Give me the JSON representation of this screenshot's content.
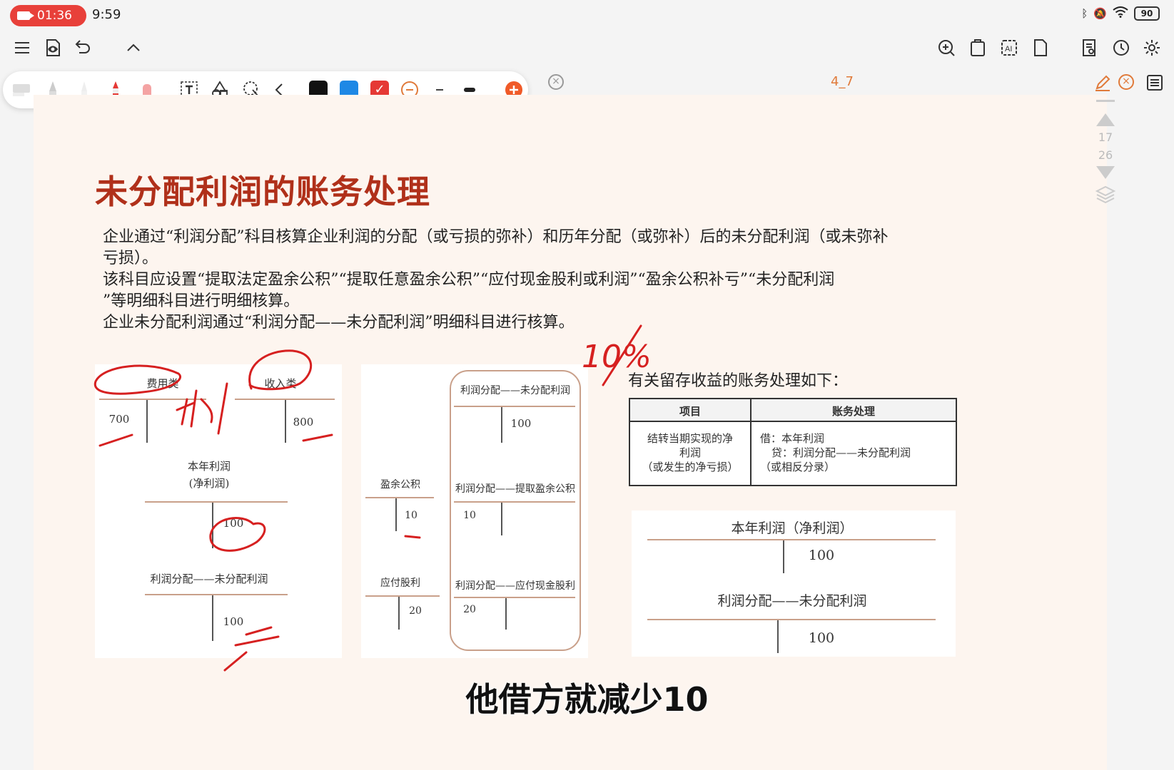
{
  "status": {
    "recording_time": "01:36",
    "clock": "9:59",
    "battery": "90"
  },
  "document": {
    "title": "4_7",
    "page_numbers": [
      "17",
      "26"
    ]
  },
  "slide": {
    "title": "未分配利润的账务处理",
    "paragraphs": [
      "企业通过“利润分配”科目核算企业利润的分配（或亏损的弥补）和历年分配（或弥补）后的未分配利润（或未弥补",
      "亏损）。",
      "该科目应设置“提取法定盈余公积”“提取任意盈余公积”“应付现金股利或利润”“盈余公积补亏”“未分配利润",
      "”等明细科目进行明细核算。",
      "企业未分配利润通过“利润分配——未分配利润”明细科目进行核算。"
    ],
    "left_diagram": {
      "expense_label": "费用类",
      "revenue_label": "收入类",
      "expense_value": "700",
      "revenue_value": "800",
      "profit_account_line1": "本年利润",
      "profit_account_line2": "(净利润)",
      "profit_value": "100",
      "dist_account": "利润分配——未分配利润",
      "dist_value": "100"
    },
    "middle_diagram": {
      "top_account": "利润分配——未分配利润",
      "top_value": "100",
      "surplus_account": "盈余公积",
      "surplus_value": "10",
      "extract_account": "利润分配——提取盈余公积",
      "extract_value": "10",
      "dividend_account": "应付股利",
      "dividend_value": "20",
      "cash_div_account": "利润分配——应付现金股利",
      "cash_div_value": "20"
    },
    "right_intro": "有关留存收益的账务处理如下：",
    "info_table": {
      "header_item": "项目",
      "header_treatment": "账务处理",
      "item_line1": "结转当期实现的净",
      "item_line2": "利润",
      "item_line3": "（或发生的净亏损）",
      "treat_line1": "借：本年利润",
      "treat_line2": "贷：利润分配——未分配利润",
      "treat_line3": "（或相反分录）"
    },
    "right_diagram": {
      "profit_account": "本年利润（净利润）",
      "profit_value": "100",
      "dist_account": "利润分配——未分配利润",
      "dist_value": "100"
    },
    "handwriting": {
      "percent": "10%",
      "profit_char": "利"
    }
  },
  "subtitle": "他借方就减少10",
  "colors": {
    "record": "#e8403a",
    "title": "#b0301a",
    "page_bg": "#fdf5ef",
    "ink": "#d62020",
    "accent_orange": "#e07a3a",
    "swatch_black": "#111111",
    "swatch_blue": "#1e88e5",
    "swatch_red": "#e53935"
  }
}
